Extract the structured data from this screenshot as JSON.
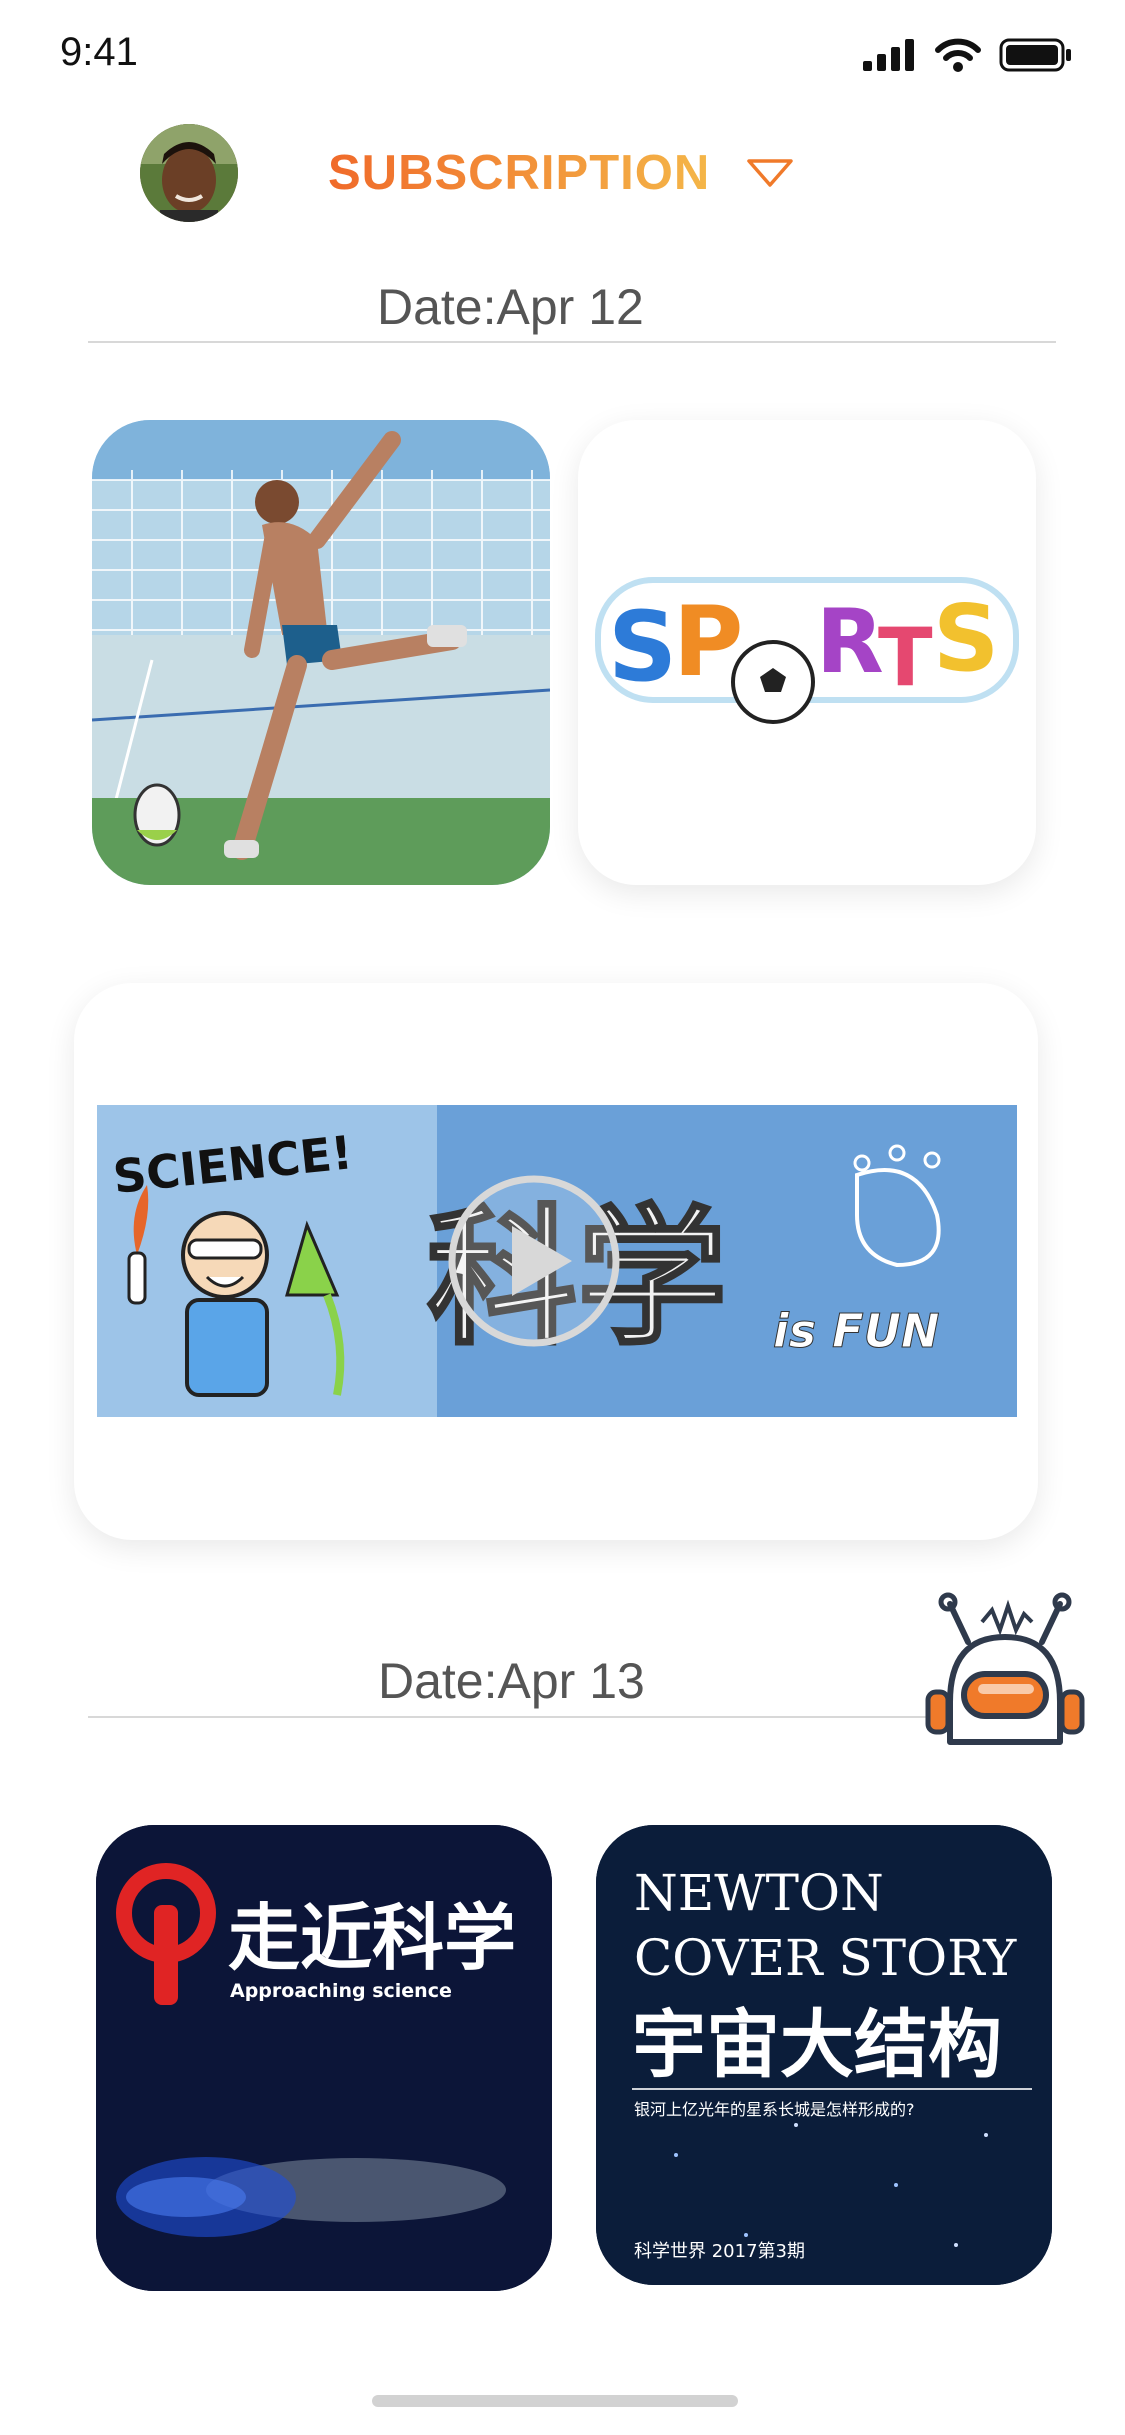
{
  "status_bar": {
    "time": "9:41"
  },
  "header": {
    "title": "SUBSCRIPTION"
  },
  "sections": [
    {
      "date": "Date:Apr 12",
      "items": [
        {
          "type": "image",
          "image": "athlete-kicking-ball-photo"
        },
        {
          "type": "image",
          "image": "sports-logo",
          "text": "SPoRTS"
        },
        {
          "type": "video",
          "image": "science-is-fun-banner",
          "science_text": "SCIENCE!",
          "chinese_text": "科学",
          "fun_text": "is FUN"
        }
      ]
    },
    {
      "date": "Date:Apr 13",
      "items": [
        {
          "type": "image",
          "image": "approaching-science-cover",
          "cn_text": "走近科学",
          "en_text": "Approaching science"
        },
        {
          "type": "image",
          "image": "newton-cover-story",
          "line1": "NEWTON",
          "line2": "COVER STORY",
          "cn_title": "宇宙大结构",
          "subtitle": "银河上亿光年的星系长城是怎样形成的?",
          "footer": "科学世界 2017第3期"
        }
      ]
    }
  ],
  "colors": {
    "accent_start": "#f06a2a",
    "accent_end": "#f4b648",
    "robot_visor": "#f07a2a"
  }
}
